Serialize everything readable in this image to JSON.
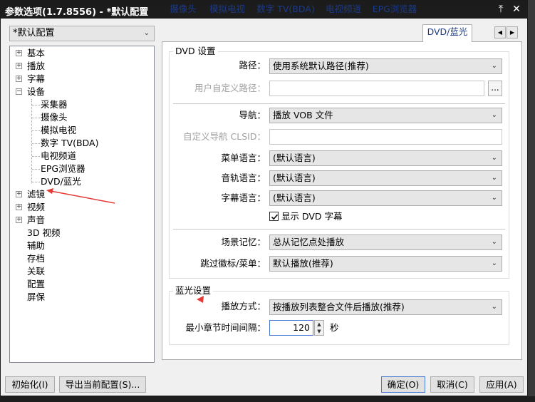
{
  "window": {
    "title": "参数选项(1.7.8556) - *默认配置"
  },
  "preset": {
    "value": "*默认配置"
  },
  "tree": {
    "items": [
      {
        "label": "基本",
        "expander": "+"
      },
      {
        "label": "播放",
        "expander": "+"
      },
      {
        "label": "字幕",
        "expander": "+"
      },
      {
        "label": "设备",
        "expander": "−"
      },
      {
        "label": "采集器"
      },
      {
        "label": "摄像头"
      },
      {
        "label": "模拟电视"
      },
      {
        "label": "数字 TV(BDA)"
      },
      {
        "label": "电视频道"
      },
      {
        "label": "EPG浏览器"
      },
      {
        "label": "DVD/蓝光"
      },
      {
        "label": "滤镜",
        "expander": "+"
      },
      {
        "label": "视频",
        "expander": "+"
      },
      {
        "label": "声音",
        "expander": "+"
      },
      {
        "label": "3D 视频"
      },
      {
        "label": "辅助"
      },
      {
        "label": "存档"
      },
      {
        "label": "关联"
      },
      {
        "label": "配置"
      },
      {
        "label": "屏保"
      }
    ]
  },
  "tabs": [
    {
      "label": "摄像头"
    },
    {
      "label": "模拟电视"
    },
    {
      "label": "数字 TV(BDA)"
    },
    {
      "label": "电视频道"
    },
    {
      "label": "EPG浏览器"
    },
    {
      "label": "DVD/蓝光"
    }
  ],
  "dvd": {
    "title": "DVD 设置",
    "path_label": "路径：",
    "path_value": "使用系统默认路径(推荐)",
    "custom_path_label": "用户自定义路径：",
    "browse_label": "...",
    "nav_label": "导航：",
    "nav_value": "播放 VOB 文件",
    "custom_nav_label": "自定义导航 CLSID：",
    "menu_lang_label": "菜单语言：",
    "menu_lang_value": "(默认语言)",
    "audio_lang_label": "音轨语言：",
    "audio_lang_value": "(默认语言)",
    "sub_lang_label": "字幕语言：",
    "sub_lang_value": "(默认语言)",
    "show_sub_label": "显示 DVD 字幕",
    "scene_label": "场景记忆：",
    "scene_value": "总从记忆点处播放",
    "skip_label": "跳过徽标/菜单：",
    "skip_value": "默认播放(推荐)"
  },
  "bluray": {
    "title": "蓝光设置",
    "mode_label": "播放方式：",
    "mode_value": "按播放列表整合文件后播放(推荐)",
    "min_chapter_label": "最小章节时间间隔：",
    "min_chapter_value": "120",
    "unit": "秒"
  },
  "buttons": {
    "init": "初始化(I)",
    "export": "导出当前配置(S)...",
    "ok": "确定(O)",
    "cancel": "取消(C)",
    "apply": "应用(A)"
  },
  "colors": {
    "annotation": "#e53935",
    "tab_text": "#1a3a8a",
    "focus": "#4a7bd0"
  }
}
